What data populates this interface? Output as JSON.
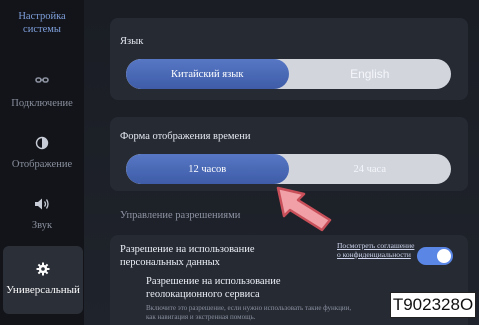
{
  "sidebar": {
    "title": "Настройка системы",
    "items": [
      {
        "label": "Подключение",
        "icon": "link-icon"
      },
      {
        "label": "Отображение",
        "icon": "contrast-icon"
      },
      {
        "label": "Звук",
        "icon": "speaker-icon"
      },
      {
        "label": "Универсальный",
        "icon": "gear-icon",
        "active": true
      }
    ]
  },
  "language": {
    "title": "Язык",
    "options": [
      "Китайский язык",
      "English"
    ],
    "selected": "Китайский язык"
  },
  "time_format": {
    "title": "Форма отображения времени",
    "options": [
      "12 часов",
      "24 часа"
    ],
    "selected": "12 часов"
  },
  "permissions": {
    "section_label": "Управление разрешениями",
    "personal_data_title": "Разрешение на использование персональных данных",
    "privacy_link": "Посмотреть соглашение о конфиденциальности",
    "toggle_on": true,
    "geo_title": "Разрешение на использование геолокационного сервиса",
    "geo_desc": "Включите это разрешение, если нужно использовать такие функции, как навигация и экстренная помощь."
  },
  "watermark": "T902328O",
  "colors": {
    "accent": "#4d6ebd",
    "toggle": "#5a86e6",
    "arrow": "#f0a0a6"
  }
}
